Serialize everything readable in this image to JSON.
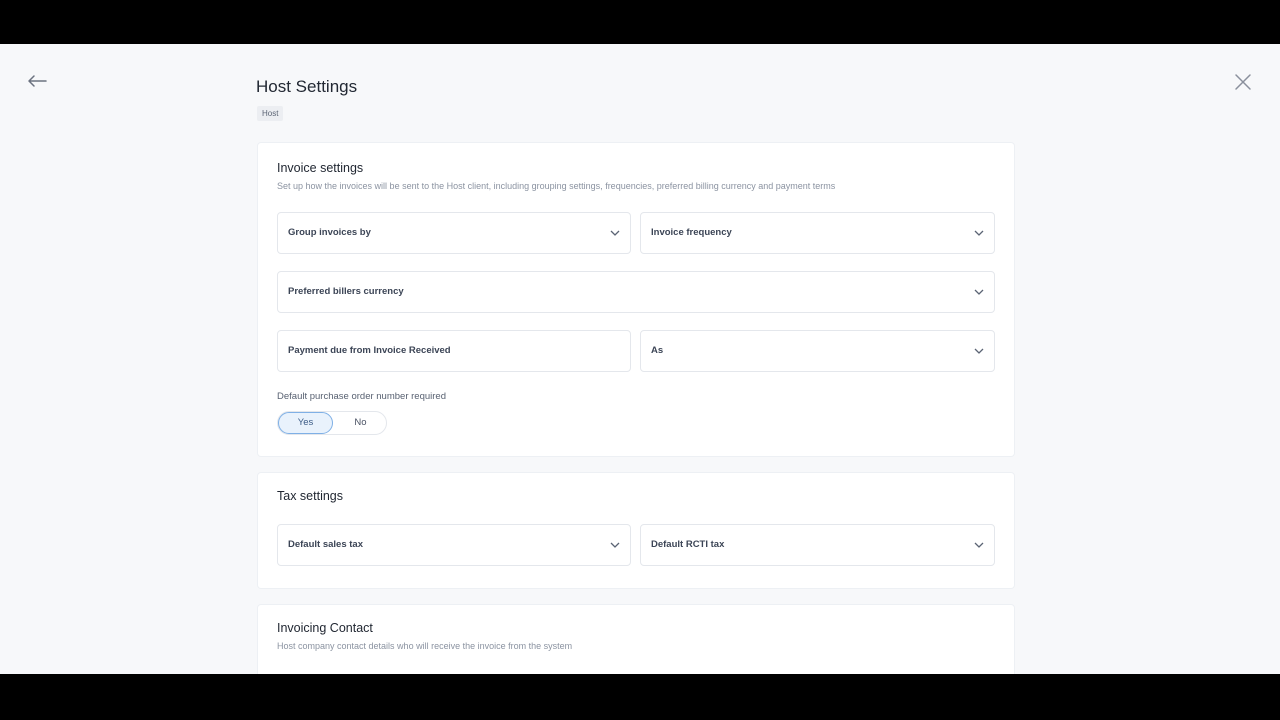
{
  "header": {
    "title": "Host Settings",
    "tag": "Host",
    "back_icon": "arrow-left-icon",
    "close_icon": "close-icon"
  },
  "invoice_settings": {
    "title": "Invoice settings",
    "subtitle": "Set up how the invoices will be sent to the Host client, including grouping settings, frequencies, preferred billing currency and payment terms",
    "group_invoices_by": "Group invoices by",
    "invoice_frequency": "Invoice frequency",
    "preferred_currency": "Preferred billers currency",
    "payment_due": "Payment due from Invoice Received",
    "payment_due_as": "As",
    "po_required_label": "Default purchase order number required",
    "po_options": [
      "Yes",
      "No"
    ],
    "po_selected": "Yes"
  },
  "tax_settings": {
    "title": "Tax settings",
    "default_sales_tax": "Default sales tax",
    "default_rcti_tax": "Default RCTI tax"
  },
  "invoicing_contact": {
    "title": "Invoicing Contact",
    "subtitle": "Host company contact details who will receive the invoice from the system"
  },
  "colors": {
    "accent_border": "#7fb0e6",
    "accent_bg": "#e9f2fc",
    "page_bg": "#f7f8fa"
  }
}
